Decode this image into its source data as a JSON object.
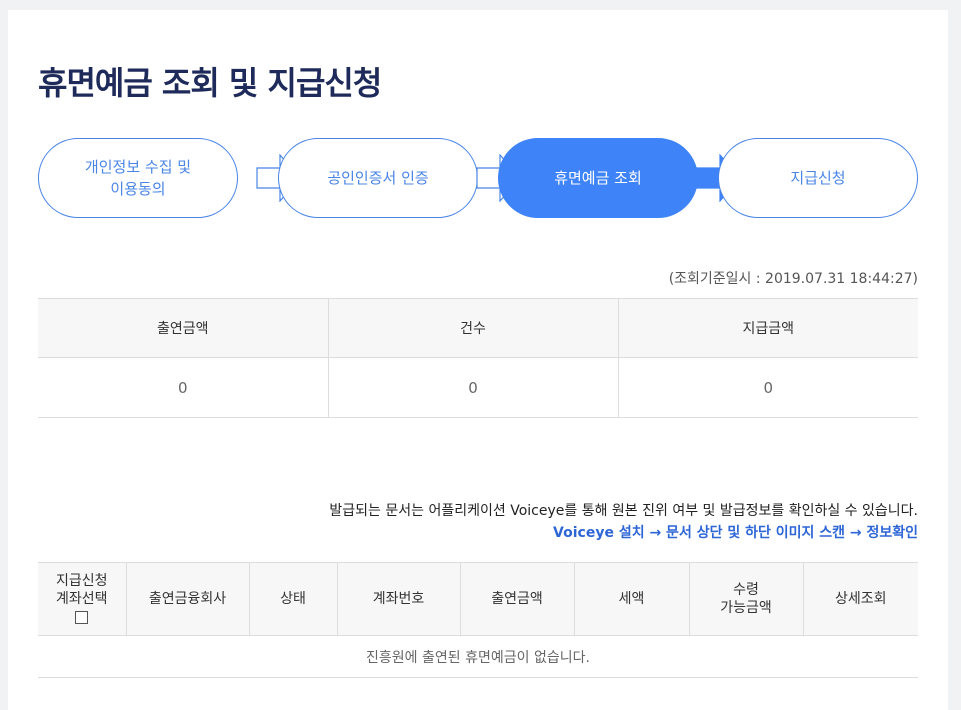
{
  "page": {
    "title": "휴면예금 조회 및 지급신청"
  },
  "steps": [
    {
      "label_line1": "개인정보 수집 및",
      "label_line2": "이용동의",
      "state": "inactive"
    },
    {
      "label_line1": "공인인증서 인증",
      "label_line2": "",
      "state": "inactive"
    },
    {
      "label_line1": "휴면예금 조회",
      "label_line2": "",
      "state": "active"
    },
    {
      "label_line1": "지급신청",
      "label_line2": "",
      "state": "inactive"
    }
  ],
  "timestamp": "(조회기준일시 : 2019.07.31 18:44:27)",
  "summary": {
    "headers": [
      "출연금액",
      "건수",
      "지급금액"
    ],
    "values": [
      "0",
      "0",
      "0"
    ]
  },
  "notice": {
    "text": "발급되는 문서는 어플리케이션 Voiceye를 통해 원본 진위 여부 및 발급정보를 확인하실 수 있습니다.",
    "link": "Voiceye 설치 → 문서 상단 및 하단 이미지 스캔 → 정보확인"
  },
  "detail": {
    "headers": {
      "select_line1": "지급신청",
      "select_line2": "계좌선택",
      "institution": "출연금융회사",
      "status": "상태",
      "account": "계좌번호",
      "amount": "출연금액",
      "tax": "세액",
      "receivable_line1": "수령",
      "receivable_line2": "가능금액",
      "view": "상세조회"
    },
    "empty_message": "진흥원에 출연된 휴면예금이 없습니다."
  },
  "colors": {
    "accent": "#3f83f8",
    "title": "#1e2a5a",
    "link": "#2e66d6"
  }
}
